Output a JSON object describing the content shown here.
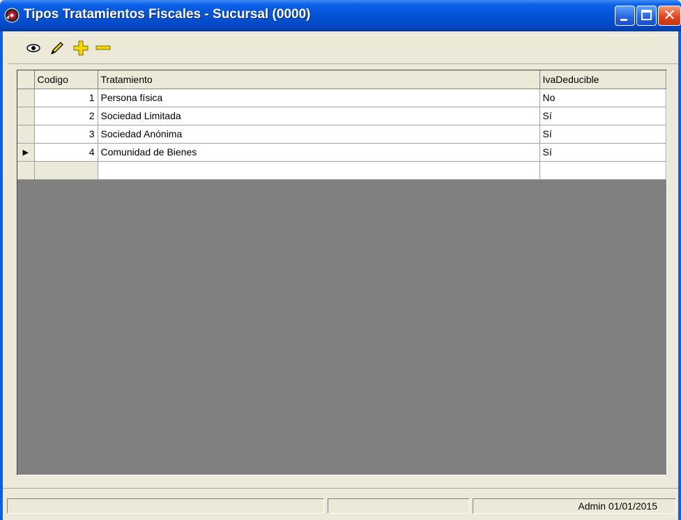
{
  "window": {
    "title": "Tipos Tratamientos Fiscales - Sucursal (0000)",
    "close_glyph": "✕"
  },
  "toolbar": {
    "icons": [
      "eye-icon",
      "pencil-icon",
      "plus-icon",
      "minus-icon"
    ]
  },
  "grid": {
    "columns": [
      "Codigo",
      "Tratamiento",
      "IvaDeducible"
    ],
    "rows": [
      {
        "codigo": "1",
        "tratamiento": "Persona física",
        "iva": "No"
      },
      {
        "codigo": "2",
        "tratamiento": "Sociedad Limitada",
        "iva": "Sí"
      },
      {
        "codigo": "3",
        "tratamiento": "Sociedad Anónima",
        "iva": "Sí"
      },
      {
        "codigo": "4",
        "tratamiento": "Comunidad de Bienes",
        "iva": "Sí"
      }
    ],
    "current_row_indicator": "▶"
  },
  "statusbar": {
    "panel1": "",
    "panel2": "",
    "panel3": "Admin 01/01/2015"
  },
  "colors": {
    "titlebar": "#0553d6",
    "face": "#ece9d8",
    "grid_background": "#808080",
    "toolbar_icon_yellow": "#f5d800"
  }
}
